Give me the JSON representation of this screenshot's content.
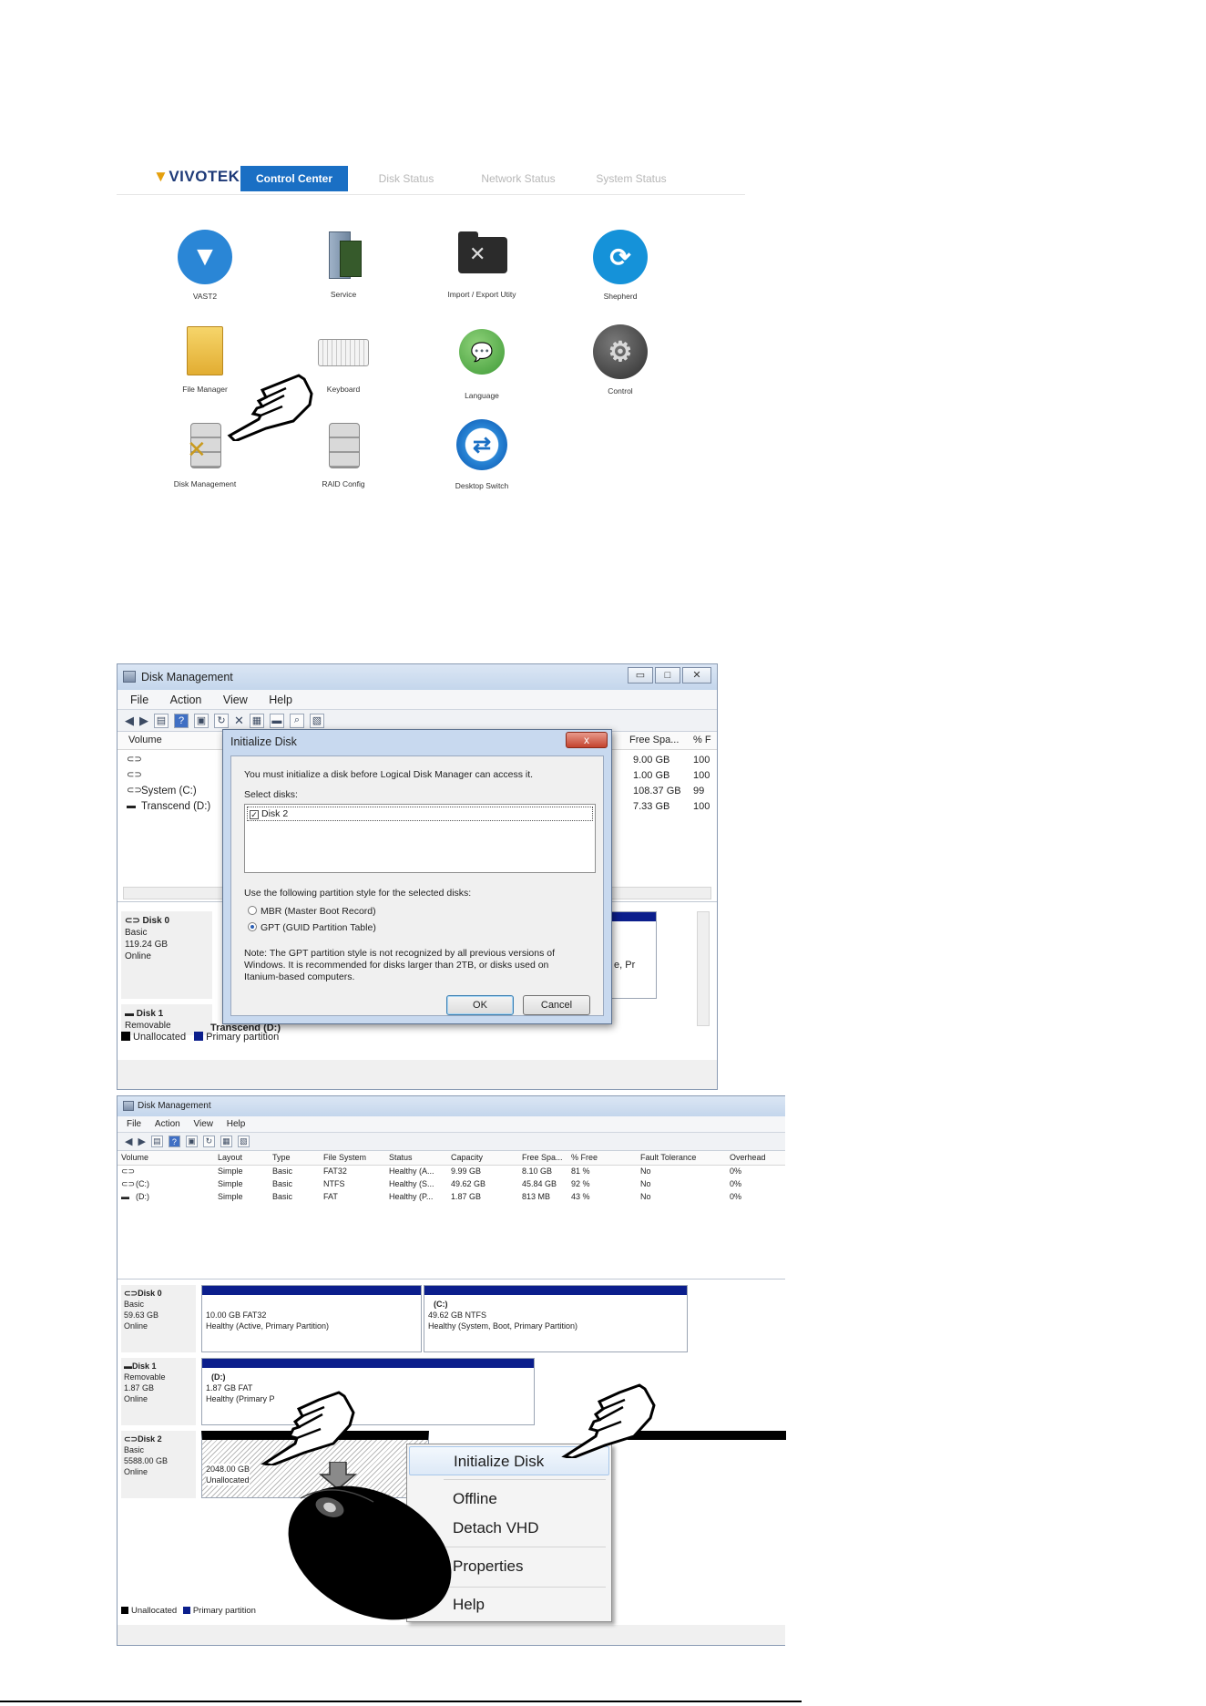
{
  "control_center": {
    "brand": "VIVOTEK",
    "tabs": [
      {
        "label": "Control Center",
        "active": true
      },
      {
        "label": "Disk Status",
        "active": false
      },
      {
        "label": "Network Status",
        "active": false
      },
      {
        "label": "System Status",
        "active": false
      }
    ],
    "items": [
      {
        "label": "VAST2",
        "icon": "vast2-icon"
      },
      {
        "label": "Service",
        "icon": "service-icon"
      },
      {
        "label": "Import / Export Utity",
        "icon": "import-export-icon"
      },
      {
        "label": "Shepherd",
        "icon": "shepherd-icon"
      },
      {
        "label": "File Manager",
        "icon": "folder-icon"
      },
      {
        "label": "Keyboard",
        "icon": "keyboard-icon"
      },
      {
        "label": "Language",
        "icon": "language-icon"
      },
      {
        "label": "Control",
        "icon": "gear-icon"
      },
      {
        "label": "Disk Management",
        "icon": "disk-management-icon"
      },
      {
        "label": "RAID Config",
        "icon": "raid-icon"
      },
      {
        "label": "Desktop Switch",
        "icon": "desktop-switch-icon"
      }
    ]
  },
  "dm1": {
    "title": "Disk Management",
    "menu": [
      "File",
      "Action",
      "View",
      "Help"
    ],
    "col_volume": "Volume",
    "col_free": "Free Spa...",
    "col_pct": "% F",
    "volumes": [
      {
        "name": "",
        "free": "9.00 GB",
        "pct": "100"
      },
      {
        "name": "",
        "free": "1.00 GB",
        "pct": "100"
      },
      {
        "name": "System (C:)",
        "free": "108.37 GB",
        "pct": "99"
      },
      {
        "name": "Transcend (D:)",
        "free": "7.33 GB",
        "pct": "100"
      }
    ],
    "disk0": {
      "name": "Disk 0",
      "type": "Basic",
      "size": "119.24 GB",
      "status": "Online",
      "partial_label": "e, Pr"
    },
    "disk1": {
      "name": "Disk 1",
      "type": "Removable",
      "part_label": "Transcend (D:)"
    },
    "legend_unalloc": "Unallocated",
    "legend_primary": "Primary partition"
  },
  "dialog": {
    "title": "Initialize Disk",
    "close": "x",
    "intro": "You must initialize a disk before Logical Disk Manager can access it.",
    "select_label": "Select disks:",
    "disk_item": "Disk 2",
    "style_label": "Use the following partition style for the selected disks:",
    "mbr": "MBR (Master Boot Record)",
    "gpt": "GPT (GUID Partition Table)",
    "note": "Note: The GPT partition style is not recognized by all previous versions of Windows. It is recommended for disks larger than 2TB, or disks used on Itanium-based computers.",
    "ok": "OK",
    "cancel": "Cancel"
  },
  "dm2": {
    "title": "Disk Management",
    "menu": [
      "File",
      "Action",
      "View",
      "Help"
    ],
    "headers": [
      "Volume",
      "Layout",
      "Type",
      "File System",
      "Status",
      "Capacity",
      "Free Spa...",
      "% Free",
      "Fault Tolerance",
      "Overhead"
    ],
    "rows": [
      [
        "",
        "Simple",
        "Basic",
        "FAT32",
        "Healthy (A...",
        "9.99 GB",
        "8.10 GB",
        "81 %",
        "No",
        "0%"
      ],
      [
        "(C:)",
        "Simple",
        "Basic",
        "NTFS",
        "Healthy (S...",
        "49.62 GB",
        "45.84 GB",
        "92 %",
        "No",
        "0%"
      ],
      [
        "(D:)",
        "Simple",
        "Basic",
        "FAT",
        "Healthy (P...",
        "1.87 GB",
        "813 MB",
        "43 %",
        "No",
        "0%"
      ]
    ],
    "disk0": {
      "name": "Disk 0",
      "type": "Basic",
      "size": "59.63 GB",
      "status": "Online",
      "p1_size": "10.00 GB FAT32",
      "p1_status": "Healthy (Active, Primary Partition)",
      "p2_name": "(C:)",
      "p2_size": "49.62 GB NTFS",
      "p2_status": "Healthy (System, Boot, Primary Partition)"
    },
    "disk1": {
      "name": "Disk 1",
      "type": "Removable",
      "size": "1.87 GB",
      "status": "Online",
      "p_name": "(D:)",
      "p_size": "1.87 GB FAT",
      "p_status": "Healthy (Primary P"
    },
    "disk2": {
      "name": "Disk 2",
      "type": "Basic",
      "size": "5588.00 GB",
      "status": "Online",
      "p_size": "2048.00 GB",
      "p_status": "Unallocated"
    },
    "legend_unalloc": "Unallocated",
    "legend_primary": "Primary partition"
  },
  "context_menu": {
    "items": [
      "Initialize Disk",
      "Offline",
      "Detach VHD",
      "Properties",
      "Help"
    ]
  },
  "colors": {
    "accent": "#1a6fc4",
    "primary_partition": "#0b1e8c"
  }
}
